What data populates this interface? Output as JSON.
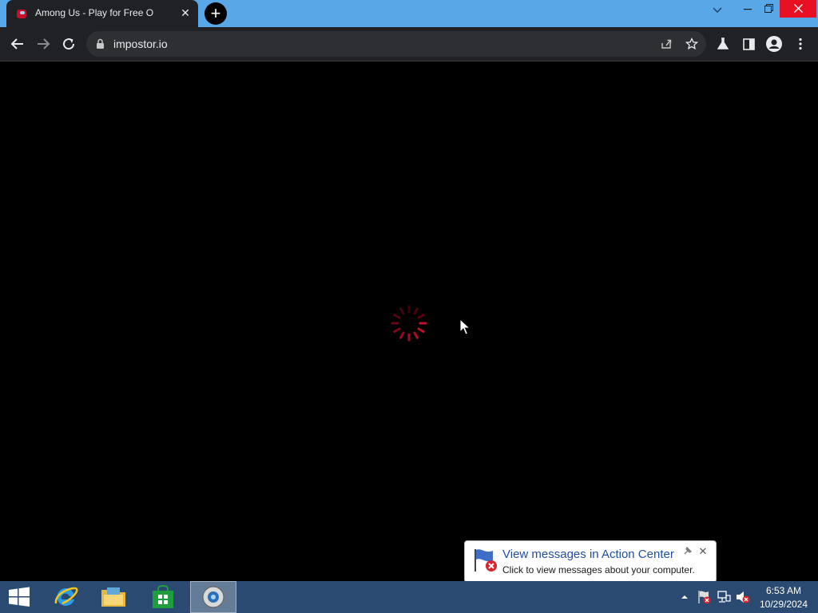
{
  "browser": {
    "tab": {
      "title": "Among Us - Play for Free O",
      "favicon": "among-us-favicon"
    },
    "url": "impostor.io",
    "window_controls": [
      "minimize-icon",
      "restore-icon",
      "close-icon"
    ]
  },
  "page": {
    "state": "loading",
    "spinner_color": "#c8102e"
  },
  "notification": {
    "title": "View messages in Action Center",
    "text": "Click to view messages about your computer."
  },
  "taskbar": {
    "apps": [
      "start-button",
      "internet-explorer",
      "file-explorer",
      "windows-store",
      "browser"
    ],
    "active_app": "browser",
    "clock": {
      "time": "6:53 AM",
      "date": "10/29/2024"
    }
  },
  "colors": {
    "titlebar": "#5aa7e8",
    "toolbar": "#202124",
    "taskbar": "#2a4a72",
    "accent": "#1f4f9e"
  }
}
